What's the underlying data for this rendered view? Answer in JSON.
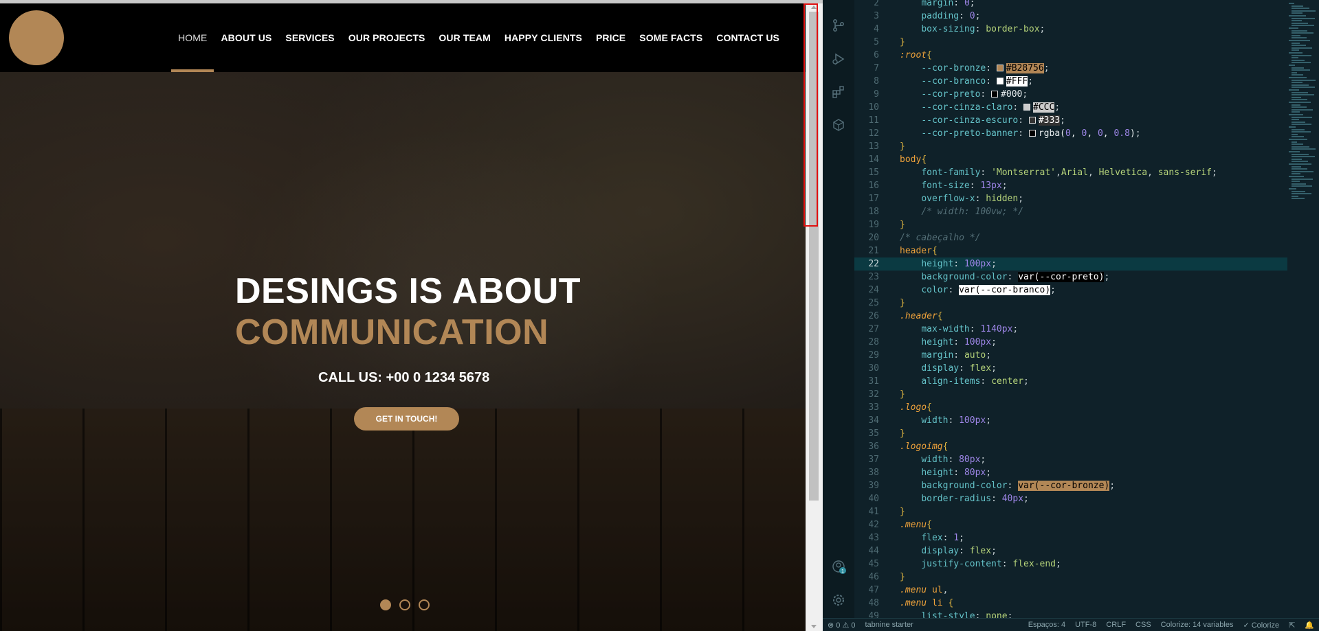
{
  "site": {
    "nav": [
      {
        "label": "HOME",
        "active": true
      },
      {
        "label": "ABOUT US"
      },
      {
        "label": "SERVICES"
      },
      {
        "label": "OUR PROJECTS"
      },
      {
        "label": "OUR TEAM"
      },
      {
        "label": "HAPPY CLIENTS"
      },
      {
        "label": "PRICE"
      },
      {
        "label": "SOME FACTS"
      },
      {
        "label": "CONTACT US"
      }
    ],
    "banner": {
      "title_line1": "DESINGS IS ABOUT",
      "title_line2": "COMMUNICATION",
      "call_us": "CALL US: +00 0 1234 5678",
      "cta_label": "GET IN TOUCH!",
      "slide_count": 3,
      "active_slide": 1
    },
    "colors": {
      "bronze": "#B28756",
      "black": "#000000",
      "white": "#FFFFFF"
    }
  },
  "editor": {
    "current_line": 22,
    "lines": [
      {
        "n": "2",
        "html": "    <span class='prop'>margin</span>: <span class='num'>0</span>;"
      },
      {
        "n": "3",
        "html": "    <span class='prop'>padding</span>: <span class='num'>0</span>;"
      },
      {
        "n": "4",
        "html": "    <span class='prop'>box-sizing</span>: <span class='kw'>border-box</span>;"
      },
      {
        "n": "5",
        "html": "<span class='brace'>}</span>"
      },
      {
        "n": "6",
        "html": "<span class='sel'><i>:root</i></span><span class='brace'>{</span>"
      },
      {
        "n": "7",
        "html": "    <span class='prop'>--cor-bronze</span>: <span class='swatch' style='background:#B28756'></span><span class='hl-bronze'>#B28756</span>;"
      },
      {
        "n": "8",
        "html": "    <span class='prop'>--cor-branco</span>: <span class='swatch' style='background:#FFF'></span><span class='hl-white'>#FFF</span>;"
      },
      {
        "n": "9",
        "html": "    <span class='prop'>--cor-preto</span>: <span class='swatch' style='background:#000'></span><span class='plain'>#000</span>;"
      },
      {
        "n": "10",
        "html": "    <span class='prop'>--cor-cinza-claro</span>: <span class='swatch' style='background:#CCC'></span><span class='hl-ccc'>#CCC</span>;"
      },
      {
        "n": "11",
        "html": "    <span class='prop'>--cor-cinza-escuro</span>: <span class='swatch' style='background:#333'></span><span class='hl-333'>#333</span>;"
      },
      {
        "n": "12",
        "html": "    <span class='prop'>--cor-preto-banner</span>: <span class='swatch' style='background:#000'></span><span class='plain'>rgba(<span class='num'>0</span>, <span class='num'>0</span>, <span class='num'>0</span>, <span class='num'>0.8</span>)</span>;"
      },
      {
        "n": "13",
        "html": "<span class='brace'>}</span>"
      },
      {
        "n": "14",
        "html": "<span class='sel'>body</span><span class='brace'>{</span>"
      },
      {
        "n": "15",
        "html": "    <span class='prop'>font-family</span>: <span class='str'>'Montserrat'</span>,<span class='kw'>Arial</span>, <span class='kw'>Helvetica</span>, <span class='kw'>sans-serif</span>;"
      },
      {
        "n": "16",
        "html": "    <span class='prop'>font-size</span>: <span class='num'>13px</span>;"
      },
      {
        "n": "17",
        "html": "    <span class='prop'>overflow-x</span>: <span class='kw'>hidden</span>;"
      },
      {
        "n": "18",
        "html": "    <span class='comment'>/* width: 100vw; */</span>"
      },
      {
        "n": "19",
        "html": "<span class='brace'>}</span>"
      },
      {
        "n": "20",
        "html": "<span class='comment'>/* cabeçalho */</span>"
      },
      {
        "n": "21",
        "html": "<span class='sel'>header</span><span class='brace'>{</span>"
      },
      {
        "n": "22",
        "html": "    <span class='prop'>height</span>: <span class='num'>100px</span>;"
      },
      {
        "n": "23",
        "html": "    <span class='prop'>background-color</span>: <span class='hl-var'>var(--cor-preto)</span>;"
      },
      {
        "n": "24",
        "html": "    <span class='prop'>color</span>: <span class='hl-white'>var(--cor-branco)</span>;"
      },
      {
        "n": "25",
        "html": "<span class='brace'>}</span>"
      },
      {
        "n": "26",
        "html": "<span class='sel'><i>.header</i></span><span class='brace'>{</span>"
      },
      {
        "n": "27",
        "html": "    <span class='prop'>max-width</span>: <span class='num'>1140px</span>;"
      },
      {
        "n": "28",
        "html": "    <span class='prop'>height</span>: <span class='num'>100px</span>;"
      },
      {
        "n": "29",
        "html": "    <span class='prop'>margin</span>: <span class='kw'>auto</span>;"
      },
      {
        "n": "30",
        "html": "    <span class='prop'>display</span>: <span class='kw'>flex</span>;"
      },
      {
        "n": "31",
        "html": "    <span class='prop'>align-items</span>: <span class='kw'>center</span>;"
      },
      {
        "n": "32",
        "html": "<span class='brace'>}</span>"
      },
      {
        "n": "33",
        "html": "<span class='sel'><i>.logo</i></span><span class='brace'>{</span>"
      },
      {
        "n": "34",
        "html": "    <span class='prop'>width</span>: <span class='num'>100px</span>;"
      },
      {
        "n": "35",
        "html": "<span class='brace'>}</span>"
      },
      {
        "n": "36",
        "html": "<span class='sel'><i>.logoimg</i></span><span class='brace'>{</span>"
      },
      {
        "n": "37",
        "html": "    <span class='prop'>width</span>: <span class='num'>80px</span>;"
      },
      {
        "n": "38",
        "html": "    <span class='prop'>height</span>: <span class='num'>80px</span>;"
      },
      {
        "n": "39",
        "html": "    <span class='prop'>background-color</span>: <span class='hl-bronze'>var(--cor-bronze)</span>;"
      },
      {
        "n": "40",
        "html": "    <span class='prop'>border-radius</span>: <span class='num'>40px</span>;"
      },
      {
        "n": "41",
        "html": "<span class='brace'>}</span>"
      },
      {
        "n": "42",
        "html": "<span class='sel'><i>.menu</i></span><span class='brace'>{</span>"
      },
      {
        "n": "43",
        "html": "    <span class='prop'>flex</span>: <span class='num'>1</span>;"
      },
      {
        "n": "44",
        "html": "    <span class='prop'>display</span>: <span class='kw'>flex</span>;"
      },
      {
        "n": "45",
        "html": "    <span class='prop'>justify-content</span>: <span class='kw'>flex-end</span>;"
      },
      {
        "n": "46",
        "html": "<span class='brace'>}</span>"
      },
      {
        "n": "47",
        "html": "<span class='sel'><i>.menu</i> ul</span>,"
      },
      {
        "n": "48",
        "html": "<span class='sel'><i>.menu</i> li</span> <span class='brace'>{</span>"
      },
      {
        "n": "49",
        "html": "    <span class='prop'>list-style</span>: <span class='kw'>none</span>;"
      }
    ],
    "activity_icons": [
      "source-control-icon",
      "run-debug-icon",
      "extensions-icon",
      "remote-icon"
    ],
    "bottom_icons": [
      "account-icon",
      "settings-icon"
    ],
    "account_badge": "1"
  },
  "statusbar": {
    "problems": "⊗ 0 ⚠ 0",
    "tabnine": "tabnine starter",
    "spaces": "Espaços: 4",
    "encoding": "UTF-8",
    "eol": "CRLF",
    "language": "CSS",
    "colorize_vars": "Colorize: 14 variables",
    "colorize": "✓ Colorize"
  }
}
